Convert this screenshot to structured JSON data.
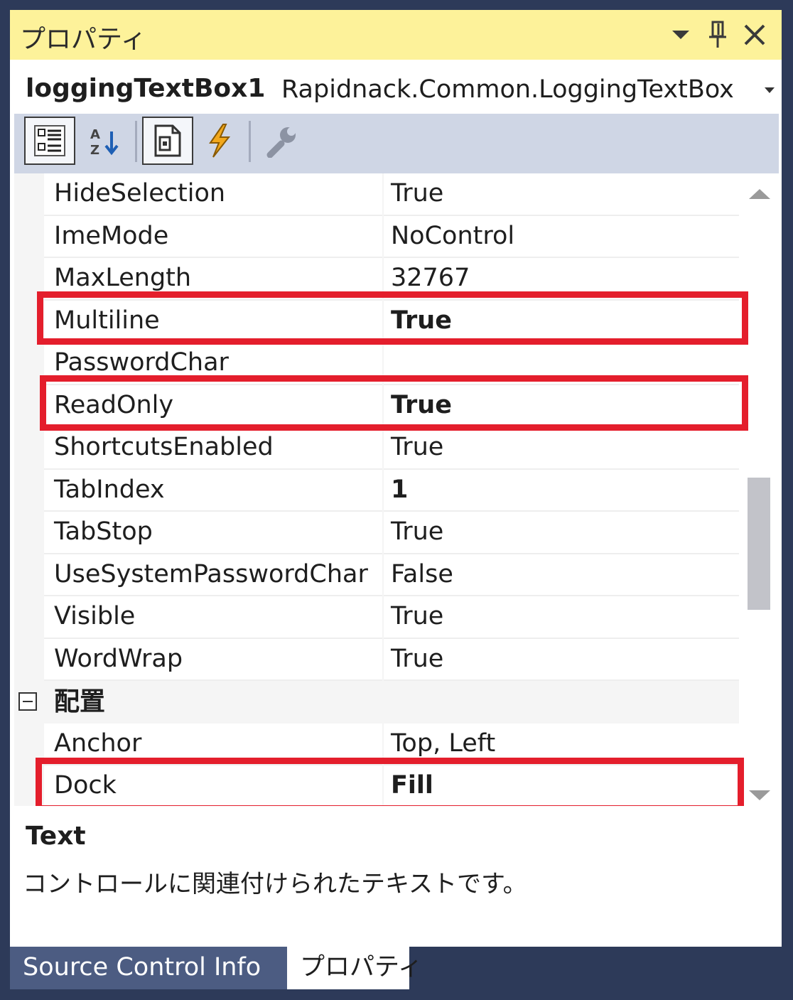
{
  "window": {
    "title": "プロパティ",
    "dropdown_icon": "▼",
    "pin_icon": "pin-icon",
    "close_icon": "×"
  },
  "object_selector": {
    "name": "loggingTextBox1",
    "type": "Rapidnack.Common.LoggingTextBox",
    "dropdown": "▾"
  },
  "toolbar": {
    "buttons": [
      "categorized-icon",
      "alphabetical-icon",
      "properties-icon",
      "events-icon",
      "property-pages-icon"
    ]
  },
  "properties": [
    {
      "name": "HideSelection",
      "value": "True",
      "bold": false
    },
    {
      "name": "ImeMode",
      "value": "NoControl",
      "bold": false
    },
    {
      "name": "MaxLength",
      "value": "32767",
      "bold": false
    },
    {
      "name": "Multiline",
      "value": "True",
      "bold": true
    },
    {
      "name": "PasswordChar",
      "value": "",
      "bold": false
    },
    {
      "name": "ReadOnly",
      "value": "True",
      "bold": true
    },
    {
      "name": "ShortcutsEnabled",
      "value": "True",
      "bold": false
    },
    {
      "name": "TabIndex",
      "value": "1",
      "bold": true
    },
    {
      "name": "TabStop",
      "value": "True",
      "bold": false
    },
    {
      "name": "UseSystemPasswordChar",
      "value": "False",
      "bold": false
    },
    {
      "name": "Visible",
      "value": "True",
      "bold": false
    },
    {
      "name": "WordWrap",
      "value": "True",
      "bold": false
    }
  ],
  "category": {
    "label": "配置",
    "toggle": "⊟"
  },
  "layout_properties": [
    {
      "name": "Anchor",
      "value": "Top, Left",
      "bold": false
    },
    {
      "name": "Dock",
      "value": "Fill",
      "bold": true
    }
  ],
  "description": {
    "title": "Text",
    "text": "コントロールに関連付けられたテキストです。"
  },
  "tabs": [
    {
      "label": "Source Control Info",
      "active": false
    },
    {
      "label": "プロパティ",
      "active": true
    }
  ],
  "colors": {
    "title_bar": "#fdf29a",
    "toolbar": "#cfd6e5",
    "highlight": "#e41e2c",
    "background": "#2d3a59"
  }
}
